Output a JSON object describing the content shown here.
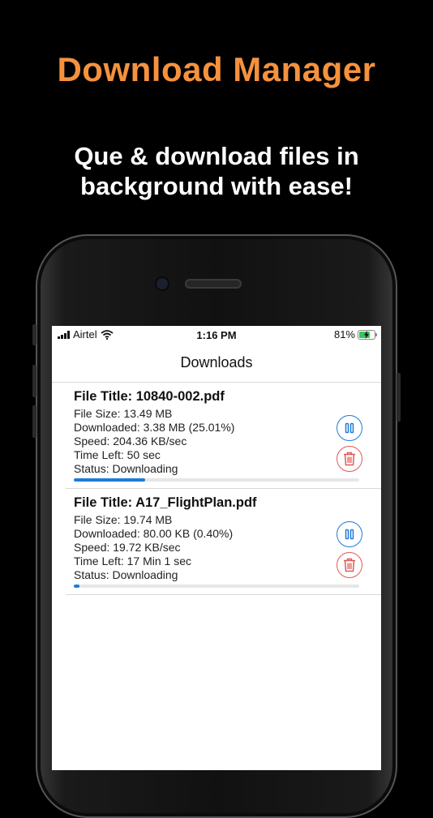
{
  "promo": {
    "headline": "Download Manager",
    "subline_1": "Que & download files in",
    "subline_2": "background with ease!",
    "headline_color": "#f5923e"
  },
  "status_bar": {
    "carrier": "Airtel",
    "time": "1:16 PM",
    "battery": "81%",
    "battery_level": 0.81
  },
  "nav": {
    "title": "Downloads"
  },
  "downloads": [
    {
      "title": "File Title: 10840-002.pdf",
      "size": "File Size: 13.49 MB",
      "downloaded": "Downloaded: 3.38 MB (25.01%)",
      "speed": "Speed: 204.36 KB/sec",
      "time_left": "Time Left: 50 sec",
      "status": "Status: Downloading",
      "progress": 0.2501
    },
    {
      "title": "File Title: A17_FlightPlan.pdf",
      "size": "File Size: 19.74 MB",
      "downloaded": "Downloaded: 80.00 KB (0.40%)",
      "speed": "Speed: 19.72 KB/sec",
      "time_left": "Time Left: 17 Min 1 sec",
      "status": "Status: Downloading",
      "progress": 0.004
    }
  ],
  "colors": {
    "accent": "#1e7bd8",
    "danger": "#e05a55",
    "battery": "#34c759"
  },
  "icons": {
    "pause": "pause-icon",
    "delete": "trash-icon",
    "wifi": "wifi-icon",
    "charging": "bolt-icon"
  }
}
